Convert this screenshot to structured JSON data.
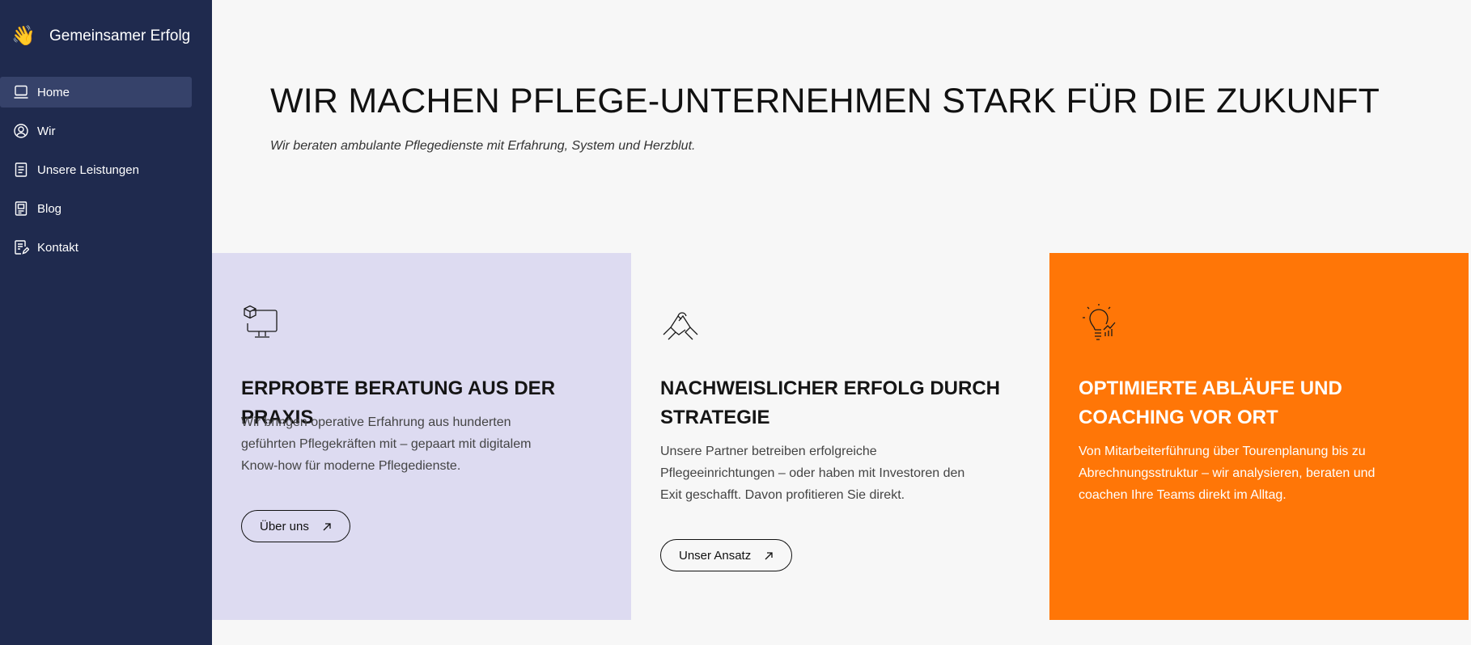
{
  "sidebar": {
    "brand": {
      "icon": "waving-hand-icon",
      "name": "Gemeinsamer Erfolg"
    },
    "items": [
      {
        "label": "Home",
        "icon": "laptop-icon",
        "active": true
      },
      {
        "label": "Wir",
        "icon": "user-circle-icon"
      },
      {
        "label": "Unsere Leistungen",
        "icon": "document-list-icon"
      },
      {
        "label": "Blog",
        "icon": "blog-post-icon"
      },
      {
        "label": "Kontakt",
        "icon": "contact-form-icon"
      }
    ]
  },
  "hero": {
    "title": "WIR MACHEN PFLEGE-UNTERNEHMEN STARK FÜR DIE ZUKUNFT",
    "subtitle": "Wir beraten ambulante Pflegedienste mit Erfahrung, System und Herzblut."
  },
  "cards": [
    {
      "icon": "monitor-box-icon",
      "title": "ERPROBTE BERATUNG AUS DER PRAXIS",
      "text": "Wir bringen operative Erfahrung aus hunderten geführten Pflegekräften mit – gepaart mit digitalem Know-how für moderne Pflegedienste.",
      "button": "Über uns"
    },
    {
      "icon": "handshake-icon",
      "title": "NACHWEISLICHER ERFOLG DURCH STRATEGIE",
      "text": "Unsere Partner betreiben erfolgreiche Pflegeeinrichtungen – oder haben mit Investoren den Exit geschafft. Davon profitieren Sie direkt.",
      "button": "Unser Ansatz"
    },
    {
      "icon": "lightbulb-chart-icon",
      "title": "OPTIMIERTE ABLÄUFE UND COACHING VOR ORT",
      "text": "Von Mitarbeiterführung über Tourenplanung bis zu Abrechnungsstruktur – wir analysieren, beraten und coachen Ihre Teams direkt im Alltag."
    }
  ],
  "colors": {
    "sidebar_bg": "#1f2a4e",
    "active_item_bg": "#36426a",
    "card_lavender": "#dddbf1",
    "card_orange": "#ff7607",
    "page_bg": "#f7f7f7"
  }
}
